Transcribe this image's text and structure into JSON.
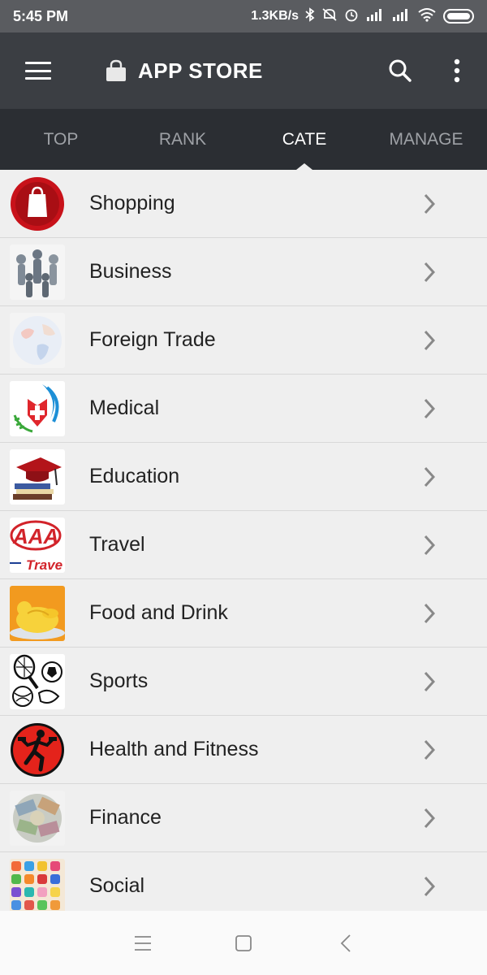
{
  "status_bar": {
    "time": "5:45 PM",
    "network_speed": "1.3KB/s",
    "icons": [
      "bluetooth-icon",
      "mute-icon",
      "alarm-icon",
      "signal-hd-icon",
      "signal-hd-icon",
      "wifi-icon",
      "battery-icon"
    ]
  },
  "app_bar": {
    "title": "APP STORE",
    "icons": [
      "menu-icon",
      "bag-icon",
      "search-icon",
      "more-vert-icon"
    ]
  },
  "tabs": [
    {
      "label": "TOP",
      "active": false
    },
    {
      "label": "RANK",
      "active": false
    },
    {
      "label": "CATE",
      "active": true
    },
    {
      "label": "MANAGE",
      "active": false
    }
  ],
  "categories": [
    {
      "label": "Shopping",
      "icon": "shopping-bag-icon"
    },
    {
      "label": "Business",
      "icon": "business-people-icon"
    },
    {
      "label": "Foreign Trade",
      "icon": "globe-icon"
    },
    {
      "label": "Medical",
      "icon": "medical-cross-icon"
    },
    {
      "label": "Education",
      "icon": "graduation-cap-icon"
    },
    {
      "label": "Travel",
      "icon": "aaa-travel-icon"
    },
    {
      "label": "Food and Drink",
      "icon": "roast-chicken-icon"
    },
    {
      "label": "Sports",
      "icon": "sports-balls-icon"
    },
    {
      "label": "Health and Fitness",
      "icon": "runner-icon"
    },
    {
      "label": "Finance",
      "icon": "money-notes-icon"
    },
    {
      "label": "Social",
      "icon": "app-grid-icon"
    }
  ],
  "nav_bar": {
    "icons": [
      "recents-icon",
      "home-icon",
      "back-icon"
    ]
  },
  "colors": {
    "status_bar": "#5a5c60",
    "app_bar": "#3b3e43",
    "tab_bar": "#2b2e33",
    "tab_active": "#ffffff",
    "tab_inactive": "#9ea1a6",
    "list_bg": "#efefef"
  },
  "icon_text": {
    "travel_logo": "AAA",
    "travel_word": "Trave"
  }
}
